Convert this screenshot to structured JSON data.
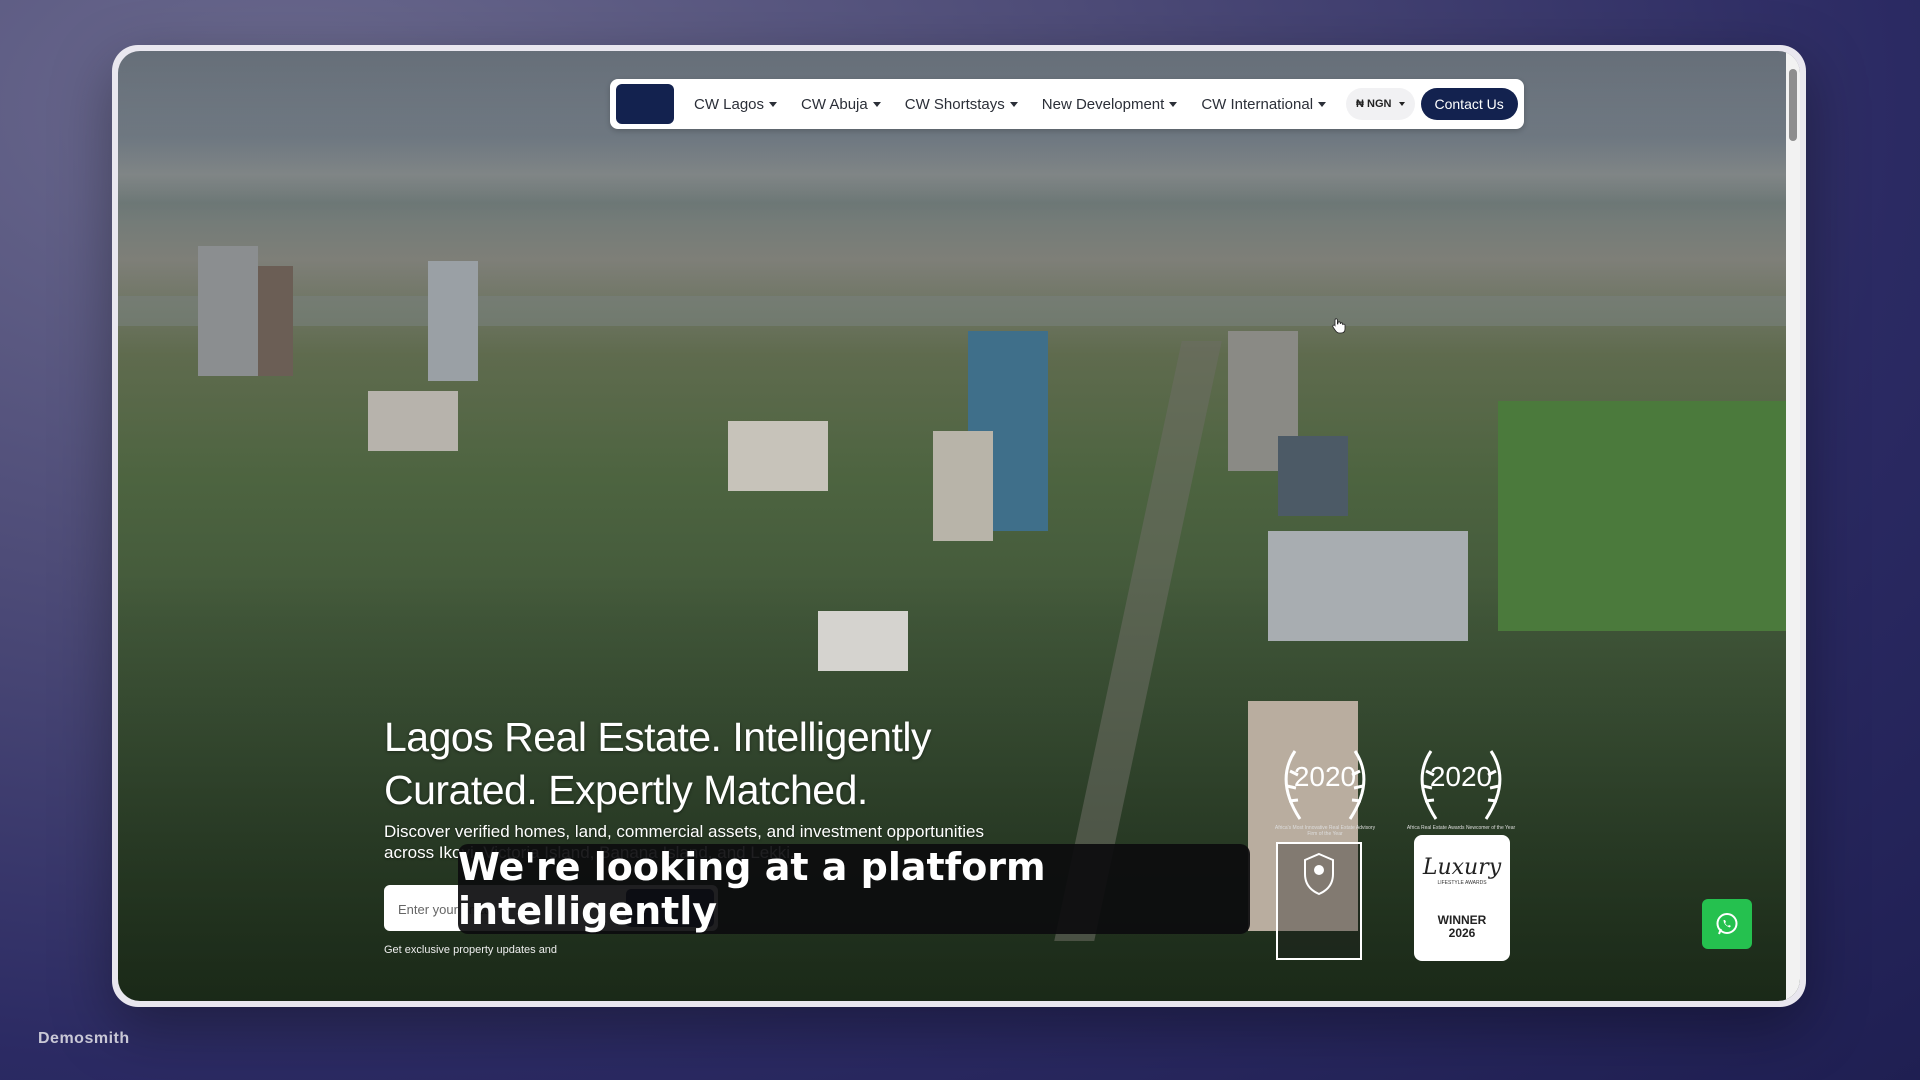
{
  "nav": {
    "items": [
      {
        "label": "CW Lagos"
      },
      {
        "label": "CW Abuja"
      },
      {
        "label": "CW Shortstays"
      },
      {
        "label": "New Development"
      },
      {
        "label": "CW International"
      }
    ],
    "currency": "₦ NGN",
    "contact_label": "Contact Us"
  },
  "hero": {
    "title": "Lagos Real Estate. Intelligently Curated. Expertly Matched.",
    "subtitle": "Discover verified homes, land, commercial assets, and investment opportunities across Ikoyi, Victoria Island, Banana Island, and Lekki.",
    "email_placeholder": "Enter your email",
    "fineprint": "Get exclusive property updates and"
  },
  "awards": [
    {
      "year": "2020",
      "caption": "Africa's Most Innovative Real Estate Advisory Firm of the Year"
    },
    {
      "year": "2020",
      "caption": "Africa Real Estate Awards Newcomer of the Year"
    }
  ],
  "luxury_award": {
    "name": "Luxury",
    "sub": "LIFESTYLE AWARDS",
    "winner": "WINNER",
    "year": "2026"
  },
  "caption": "We're looking at a platform intelligently",
  "watermark": "Demosmith",
  "colors": {
    "navy": "#13224f",
    "whatsapp": "#25c14f"
  }
}
